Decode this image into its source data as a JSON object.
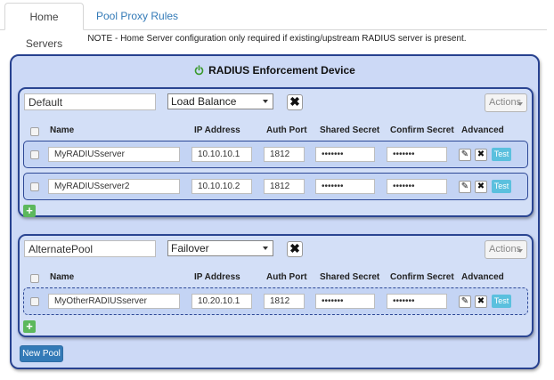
{
  "tabs": [
    {
      "label": "Home Servers",
      "active": true
    },
    {
      "label": "Pool Proxy Rules",
      "active": false
    }
  ],
  "note": "NOTE - Home Server configuration only required if existing/upstream RADIUS server is present.",
  "device": {
    "title": "RADIUS Enforcement Device",
    "icon": "power-icon"
  },
  "columns": {
    "name": "Name",
    "ip": "IP Address",
    "port": "Auth Port",
    "secret": "Shared Secret",
    "confirm": "Confirm Secret",
    "advanced": "Advanced"
  },
  "pools": [
    {
      "name": "Default",
      "type": "Load Balance",
      "actions_label": "Actions",
      "servers": [
        {
          "name": "MyRADIUSserver",
          "ip": "10.10.10.1",
          "port": "1812",
          "secret": "•••••••",
          "confirm": "•••••••",
          "test_label": "Test"
        },
        {
          "name": "MyRADIUSserver2",
          "ip": "10.10.10.2",
          "port": "1812",
          "secret": "•••••••",
          "confirm": "•••••••",
          "test_label": "Test"
        }
      ]
    },
    {
      "name": "AlternatePool",
      "type": "Failover",
      "actions_label": "Actions",
      "servers": [
        {
          "name": "MyOtherRADIUSserver",
          "ip": "10.20.10.1",
          "port": "1812",
          "secret": "•••••••",
          "confirm": "•••••••",
          "test_label": "Test"
        }
      ]
    }
  ],
  "new_pool_label": "New Pool",
  "colors": {
    "device_border": "#27418f",
    "device_bg": "#ccd9f6",
    "link": "#337ab7",
    "test_btn": "#5bc0de",
    "add_btn": "#5cb85c",
    "power_icon": "#3a9a2c"
  }
}
